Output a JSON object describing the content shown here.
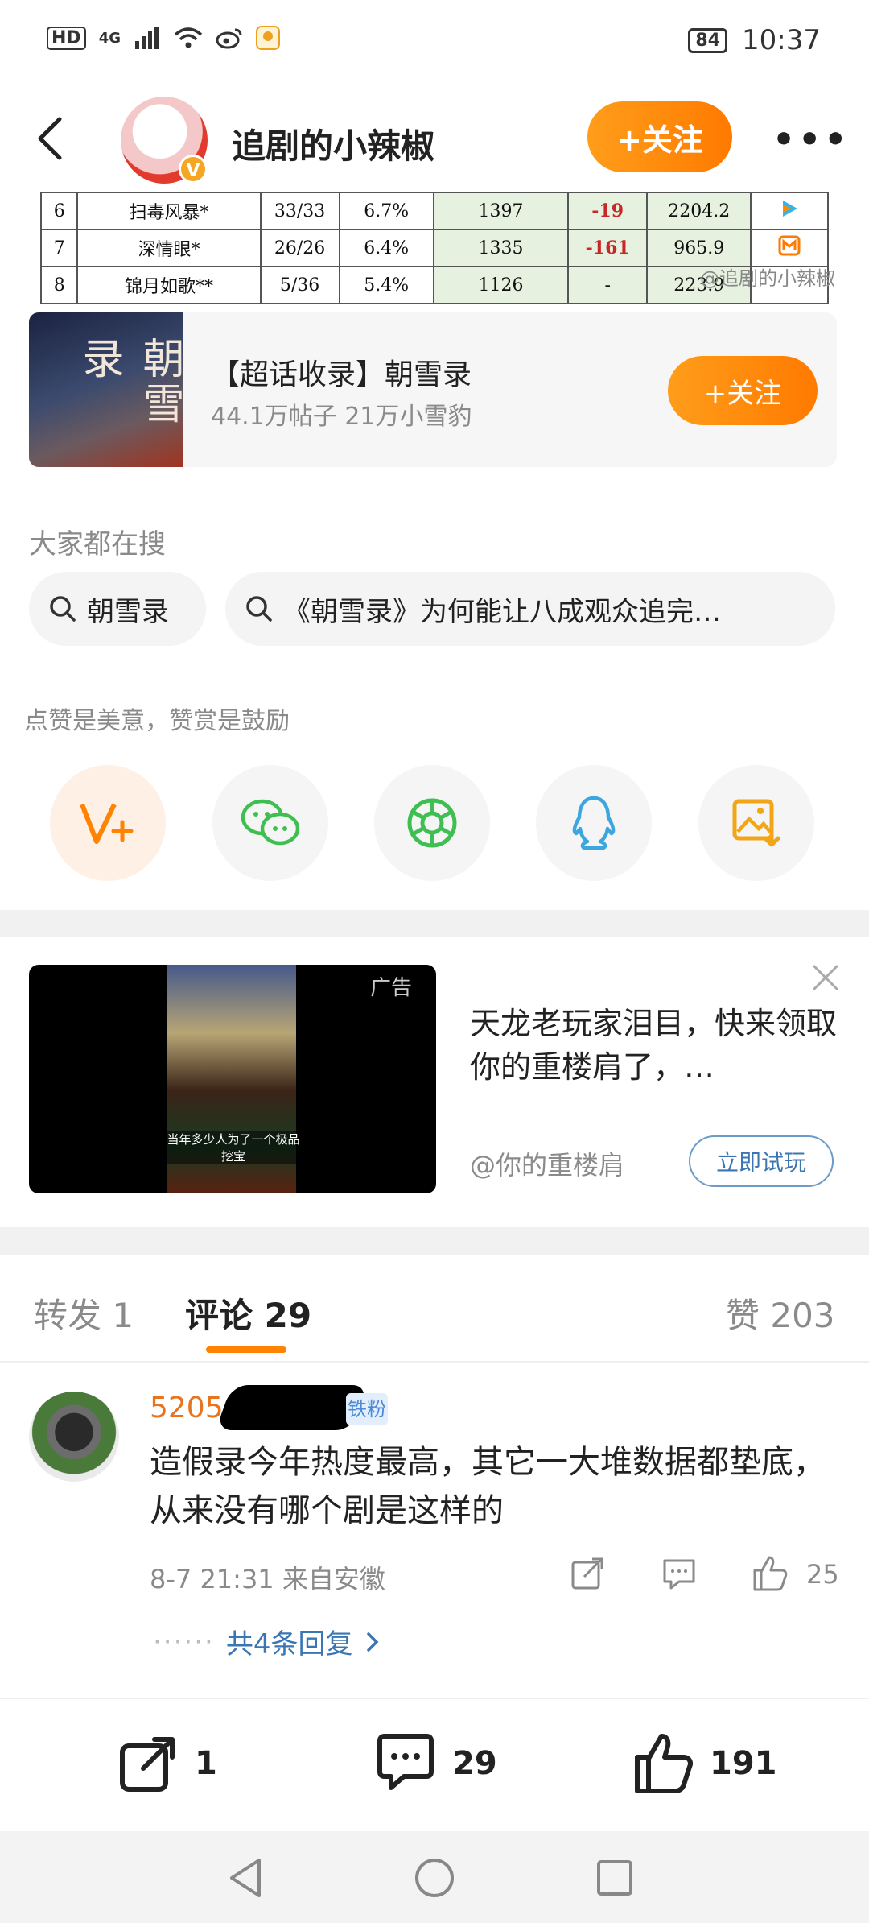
{
  "status_bar": {
    "network_hd": "HD",
    "network_gen": "4G",
    "battery": "84",
    "time": "10:37"
  },
  "header": {
    "title": "追剧的小辣椒",
    "follow_label": "+关注",
    "verified_badge": "V"
  },
  "ranking_rows": [
    {
      "rank": "6",
      "name": "扫毒风暴*",
      "episodes": "33/33",
      "share": "6.7%",
      "heat": "1397",
      "change": "-19",
      "total": "2204.2",
      "platform_icon": "tencent-video-icon"
    },
    {
      "rank": "7",
      "name": "深情眼*",
      "episodes": "26/26",
      "share": "6.4%",
      "heat": "1335",
      "change": "-161",
      "total": "965.9",
      "platform_icon": "mango-tv-icon"
    },
    {
      "rank": "8",
      "name": "锦月如歌**",
      "episodes": "5/36",
      "share": "5.4%",
      "heat": "1126",
      "change": "-",
      "total": "223.9",
      "platform_icon": ""
    }
  ],
  "watermark": "@追剧的小辣椒",
  "topic_card": {
    "thumb_text": "朝雪录",
    "title": "【超话收录】朝雪录",
    "subtitle": "44.1万帖子 21万小雪豹",
    "follow_label": "+关注"
  },
  "search": {
    "label": "大家都在搜",
    "chips": [
      "朝雪录",
      "《朝雪录》为何能让八成观众追完…"
    ]
  },
  "reward": {
    "label": "点赞是美意，赞赏是鼓励"
  },
  "share_targets": [
    "vplus-icon",
    "wechat-icon",
    "moments-icon",
    "qq-icon",
    "save-image-icon"
  ],
  "ad": {
    "tag": "广告",
    "video_caption": "当年多少人为了一个极品挖宝",
    "text": "天龙老玩家泪目，快来领取你的重楼肩了，…",
    "author": "@你的重楼肩",
    "cta": "立即试玩"
  },
  "tabs": {
    "repost": "转发 1",
    "comments": "评论 29",
    "likes": "赞 203"
  },
  "comment": {
    "name": "5205",
    "badge": "铁粉",
    "text": "造假录今年热度最高，其它一大堆数据都垫底，从来没有哪个剧是这样的",
    "time": "8-7 21:31  来自安徽",
    "like_count": "25",
    "replies": "共4条回复"
  },
  "bottom_bar": {
    "share_count": "1",
    "comment_count": "29",
    "like_count": "191"
  },
  "colors": {
    "accent_orange": "#ff8200",
    "link_blue": "#3b76b3",
    "name_orange": "#e8741f"
  }
}
